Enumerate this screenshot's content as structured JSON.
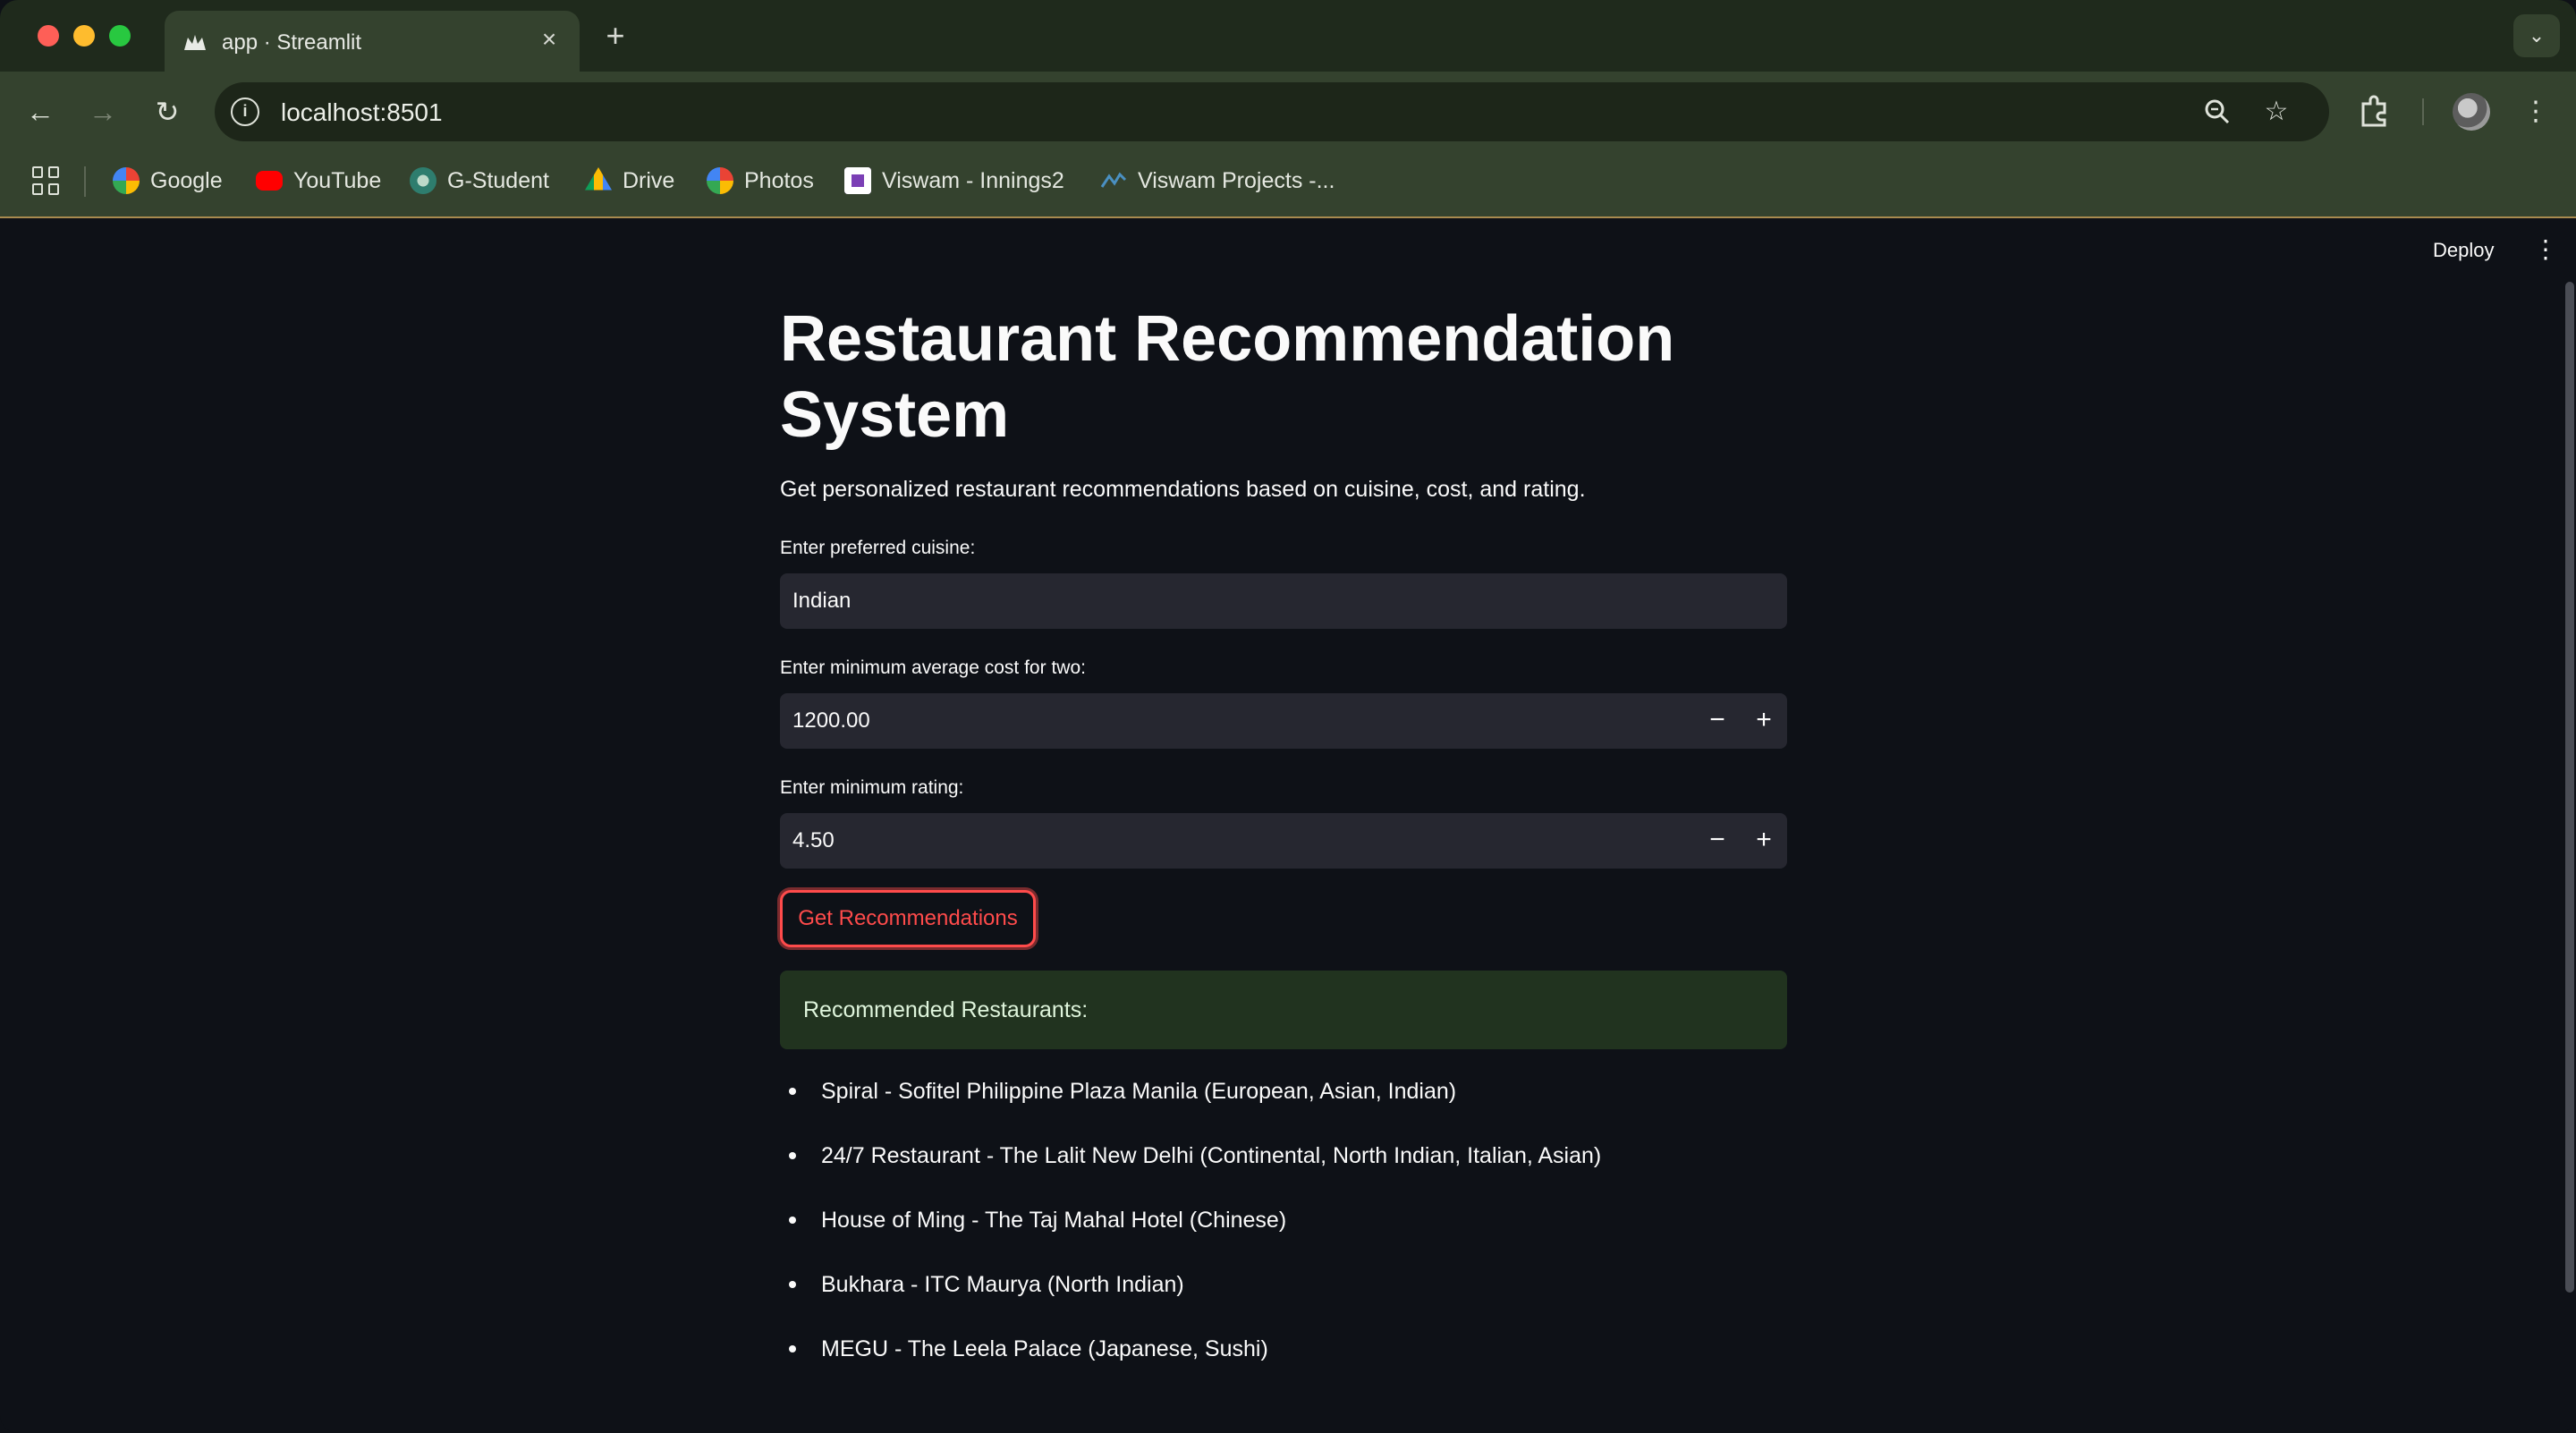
{
  "browser": {
    "tab_title": "app · Streamlit",
    "url": "localhost:8501",
    "bookmarks": [
      {
        "label": "Google",
        "icon": "google-icon",
        "color": "#4285f4"
      },
      {
        "label": "YouTube",
        "icon": "youtube-icon",
        "color": "#ff0000"
      },
      {
        "label": "G-Student",
        "icon": "g-student-icon",
        "color": "#2e7d6e"
      },
      {
        "label": "Drive",
        "icon": "drive-icon",
        "color": "#fbbc04"
      },
      {
        "label": "Photos",
        "icon": "photos-icon",
        "color": "#ea4335"
      },
      {
        "label": "Viswam - Innings2",
        "icon": "viswam-icon",
        "color": "#7b3fb5"
      },
      {
        "label": "Viswam Projects -...",
        "icon": "viswam-projects-icon",
        "color": "#4a90c2"
      }
    ]
  },
  "header": {
    "deploy_label": "Deploy"
  },
  "main": {
    "title": "Restaurant Recommendation System",
    "subtitle": "Get personalized restaurant recommendations based on cuisine, cost, and rating.",
    "cuisine": {
      "label": "Enter preferred cuisine:",
      "value": "Indian"
    },
    "cost": {
      "label": "Enter minimum average cost for two:",
      "value": "1200.00"
    },
    "rating": {
      "label": "Enter minimum rating:",
      "value": "4.50"
    },
    "button_label": "Get Recommendations",
    "alert_text": "Recommended Restaurants:",
    "results": [
      "Spiral - Sofitel Philippine Plaza Manila (European, Asian, Indian)",
      "24/7 Restaurant - The Lalit New Delhi (Continental, North Indian, Italian, Asian)",
      "House of Ming - The Taj Mahal Hotel (Chinese)",
      "Bukhara - ITC Maurya (North Indian)",
      "MEGU - The Leela Palace (Japanese, Sushi)"
    ]
  },
  "colors": {
    "accent": "#ff4b4b",
    "background": "#0e1117",
    "input_bg": "#262730",
    "success_bg": "#21331f"
  }
}
